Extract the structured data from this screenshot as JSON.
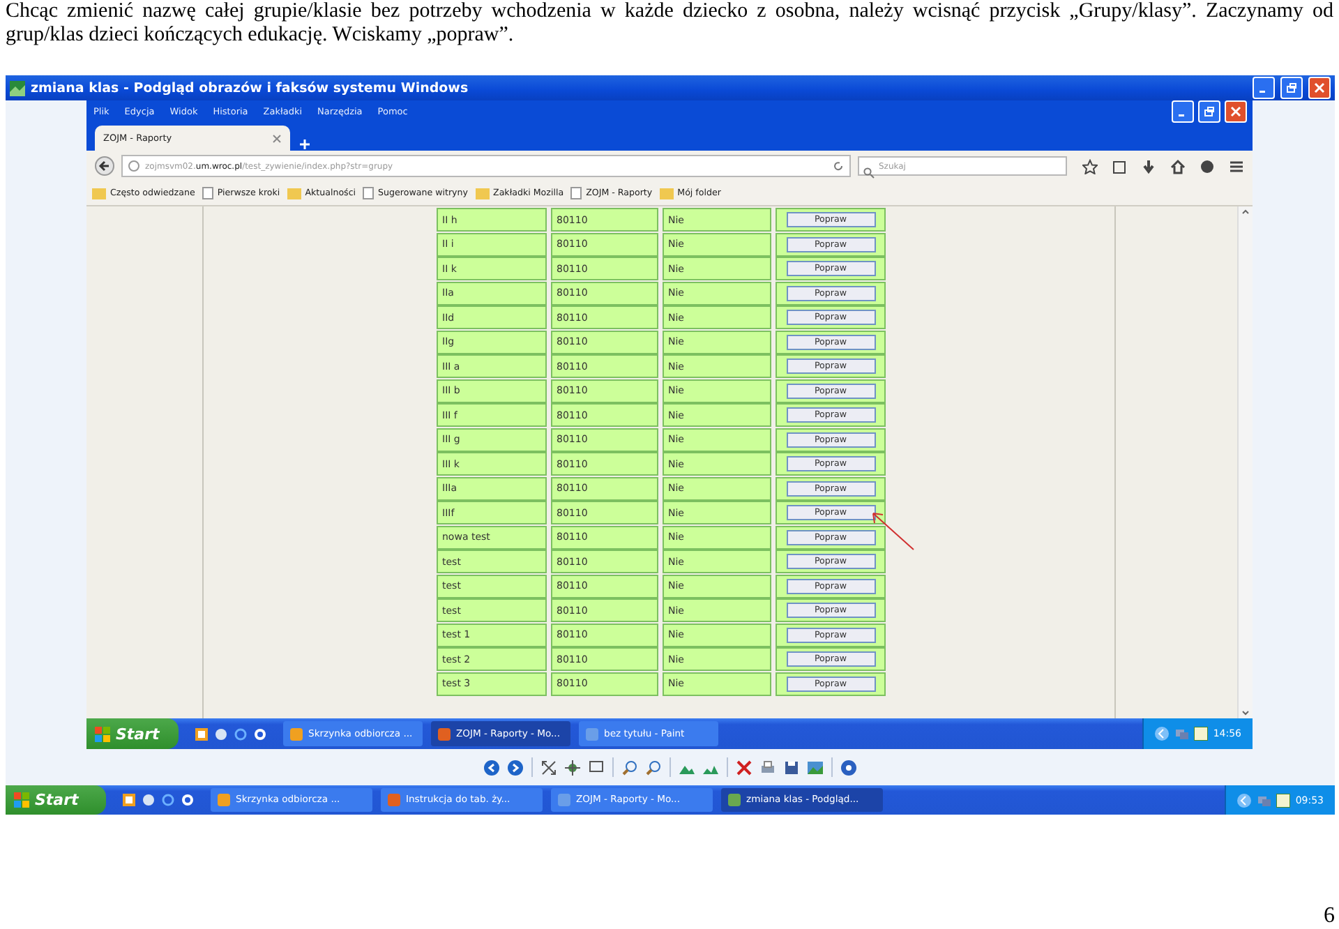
{
  "caption": "Chcąc zmienić nazwę całej grupie/klasie bez potrzeby wchodzenia w każde dziecko z osobna, należy wcisnąć przycisk „Grupy/klasy”. Zaczynamy od grup/klas dzieci kończących edukację. Wciskamy „popraw”.",
  "viewer": {
    "title": "zmiana klas - Podgląd obrazów i faksów systemu Windows"
  },
  "browser": {
    "menu": [
      "Plik",
      "Edycja",
      "Widok",
      "Historia",
      "Zakładki",
      "Narzędzia",
      "Pomoc"
    ],
    "tabs": [
      {
        "label": "ZOJM - Raporty",
        "selected": true
      }
    ],
    "url": "zojmsvm02.**um.wroc.pl**/test_zywienie/index.php?str=grupy",
    "search": {
      "placeholder": "Szukaj"
    },
    "bookmarks": [
      "Często odwiedzane",
      "Pierwsze kroki",
      "Aktualności",
      "Sugerowane witryny",
      "Zakładki Mozilla",
      "ZOJM - Raporty",
      "Mój folder"
    ],
    "rows": [
      {
        "name": "II h",
        "code": "80110",
        "flag": "Nie",
        "action": "Popraw"
      },
      {
        "name": "II i",
        "code": "80110",
        "flag": "Nie",
        "action": "Popraw"
      },
      {
        "name": "II k",
        "code": "80110",
        "flag": "Nie",
        "action": "Popraw"
      },
      {
        "name": "IIa",
        "code": "80110",
        "flag": "Nie",
        "action": "Popraw"
      },
      {
        "name": "IId",
        "code": "80110",
        "flag": "Nie",
        "action": "Popraw"
      },
      {
        "name": "IIg",
        "code": "80110",
        "flag": "Nie",
        "action": "Popraw"
      },
      {
        "name": "III a",
        "code": "80110",
        "flag": "Nie",
        "action": "Popraw"
      },
      {
        "name": "III b",
        "code": "80110",
        "flag": "Nie",
        "action": "Popraw"
      },
      {
        "name": "III f",
        "code": "80110",
        "flag": "Nie",
        "action": "Popraw"
      },
      {
        "name": "III g",
        "code": "80110",
        "flag": "Nie",
        "action": "Popraw"
      },
      {
        "name": "III k",
        "code": "80110",
        "flag": "Nie",
        "action": "Popraw"
      },
      {
        "name": "IIIa",
        "code": "80110",
        "flag": "Nie",
        "action": "Popraw"
      },
      {
        "name": "IIIf",
        "code": "80110",
        "flag": "Nie",
        "action": "Popraw"
      },
      {
        "name": "nowa test",
        "code": "80110",
        "flag": "Nie",
        "action": "Popraw"
      },
      {
        "name": "test",
        "code": "80110",
        "flag": "Nie",
        "action": "Popraw"
      },
      {
        "name": "test",
        "code": "80110",
        "flag": "Nie",
        "action": "Popraw"
      },
      {
        "name": "test",
        "code": "80110",
        "flag": "Nie",
        "action": "Popraw"
      },
      {
        "name": "test 1",
        "code": "80110",
        "flag": "Nie",
        "action": "Popraw"
      },
      {
        "name": "test 2",
        "code": "80110",
        "flag": "Nie",
        "action": "Popraw"
      },
      {
        "name": "test 3",
        "code": "80110",
        "flag": "Nie",
        "action": "Popraw"
      }
    ]
  },
  "inner_taskbar": {
    "start": "Start",
    "tasks": [
      {
        "label": "Skrzynka odbiorcza ...",
        "selected": false
      },
      {
        "label": "ZOJM - Raporty - Mo...",
        "selected": true
      },
      {
        "label": "bez tytułu - Paint",
        "selected": false
      }
    ],
    "clock": "14:56"
  },
  "outer_taskbar": {
    "start": "Start",
    "tasks": [
      {
        "label": "Skrzynka odbiorcza ...",
        "selected": false
      },
      {
        "label": "Instrukcja do tab. ży...",
        "selected": false
      },
      {
        "label": "ZOJM - Raporty - Mo...",
        "selected": false
      },
      {
        "label": "zmiana klas - Podgląd...",
        "selected": true
      }
    ],
    "clock": "09:53"
  },
  "page_number": "6"
}
